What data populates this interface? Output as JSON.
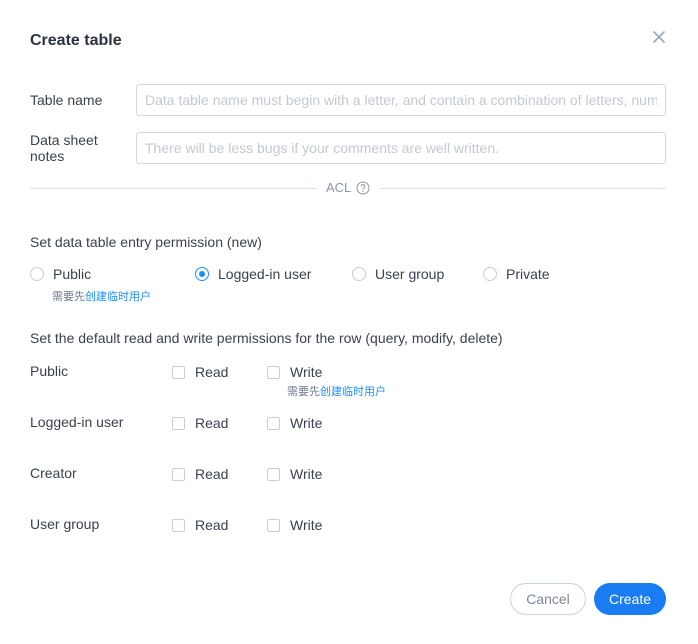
{
  "dialog": {
    "title": "Create table",
    "close_icon": "close-icon"
  },
  "fields": {
    "table_name": {
      "label": "Table name",
      "value": "",
      "placeholder": "Data table name must begin with a letter, and contain a combination of letters, numbers"
    },
    "notes": {
      "label_line1": "Data sheet",
      "label_line2": "notes",
      "value": "",
      "placeholder": "There will be less bugs if your comments are well written."
    }
  },
  "acl": {
    "divider_label": "ACL",
    "help_icon": "question-circle-icon"
  },
  "entry_permission": {
    "heading": "Set data table entry permission (new)",
    "options": [
      {
        "label": "Public",
        "checked": false
      },
      {
        "label": "Logged-in user",
        "checked": true
      },
      {
        "label": "User group",
        "checked": false
      },
      {
        "label": "Private",
        "checked": false
      }
    ],
    "hint_prefix": "需要先",
    "hint_link": "创建临时用户"
  },
  "row_permissions": {
    "heading": "Set the default read and write permissions for the row (query, modify, delete)",
    "read_label": "Read",
    "write_label": "Write",
    "rows": [
      {
        "label": "Public",
        "read": false,
        "write": false
      },
      {
        "label": "Logged-in user",
        "read": false,
        "write": false
      },
      {
        "label": "Creator",
        "read": false,
        "write": false
      },
      {
        "label": "User group",
        "read": false,
        "write": false
      }
    ],
    "hint_prefix": "需要先",
    "hint_link": "创建临时用户"
  },
  "footer": {
    "cancel_label": "Cancel",
    "create_label": "Create"
  },
  "colors": {
    "accent": "#1a7cf2",
    "link": "#1f8fff",
    "border": "#d4d9e1"
  }
}
